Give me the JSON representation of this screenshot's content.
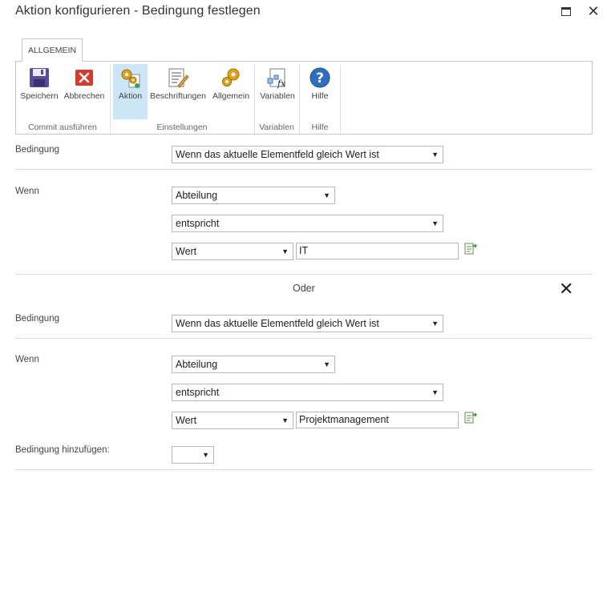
{
  "window": {
    "title": "Aktion konfigurieren - Bedingung festlegen",
    "maximize_icon": "maximize-icon",
    "close_icon": "close-icon"
  },
  "ribbon": {
    "tab_label": "ALLGEMEIN",
    "buttons": {
      "save": "Speichern",
      "cancel": "Abbrechen",
      "action": "Aktion",
      "labels": "Beschriftungen",
      "general": "Allgemein",
      "variables": "Variablen",
      "help": "Hilfe"
    },
    "groups": {
      "commit": "Commit ausführen",
      "settings": "Einstellungen",
      "variables": "Variablen",
      "help": "Hilfe"
    }
  },
  "conditions": [
    {
      "bedingung_label": "Bedingung",
      "bedingung_value": "Wenn das aktuelle Elementfeld gleich Wert ist",
      "wenn_label": "Wenn",
      "field_value": "Abteilung",
      "operator_value": "entspricht",
      "type_value": "Wert",
      "value": "IT"
    },
    {
      "bedingung_label": "Bedingung",
      "bedingung_value": "Wenn das aktuelle Elementfeld gleich Wert ist",
      "wenn_label": "Wenn",
      "field_value": "Abteilung",
      "operator_value": "entspricht",
      "type_value": "Wert",
      "value": "Projektmanagement"
    }
  ],
  "separator": {
    "label": "Oder"
  },
  "add_condition": {
    "label": "Bedingung hinzufügen:",
    "value": ""
  },
  "colors": {
    "accent": "#cde6f7",
    "border": "#c6c6c6",
    "divider": "#dcdcdc"
  }
}
